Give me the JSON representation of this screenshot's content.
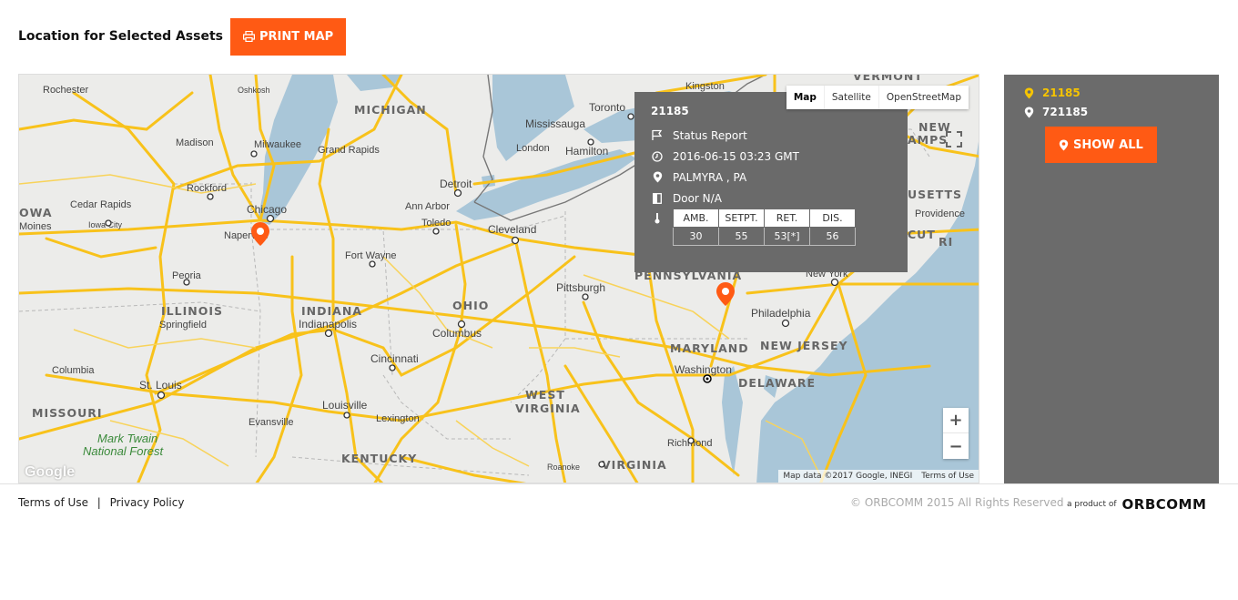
{
  "header": {
    "title": "Location for Selected Assets",
    "print_label": "PRINT MAP"
  },
  "map": {
    "map_types": [
      "Map",
      "Satellite",
      "OpenStreetMap"
    ],
    "active_map_type": "Map",
    "zoom_in": "+",
    "zoom_out": "−",
    "attribution": "Map data ©2017 Google, INEGI",
    "terms": "Terms of Use",
    "google_logo": "Google",
    "labels": {
      "michigan": "MICHIGAN",
      "illinois": "ILLINOIS",
      "indiana": "INDIANA",
      "ohio": "OHIO",
      "pennsylvania": "PENNSYLVANIA",
      "maryland": "MARYLAND",
      "new_jersey": "NEW JERSEY",
      "delaware": "DELAWARE",
      "west_virginia_1": "WEST",
      "west_virginia_2": "VIRGINIA",
      "virginia": "VIRGINIA",
      "kentucky": "KENTUCKY",
      "missouri": "MISSOURI",
      "iowa": "OWA",
      "vermont": "VERMONT",
      "new_hampshire_1": "NEW",
      "new_hampshire_2": "AMPS",
      "massachusetts": "USETTS",
      "connecticut": "CUT",
      "rhode_island": "RI",
      "mark_twain_1": "Mark Twain",
      "mark_twain_2": "National Forest",
      "rochester": "Rochester",
      "oshkosh": "Oshkosh",
      "madison": "Madison",
      "milwaukee": "Milwaukee",
      "grand_rapids": "Grand Rapids",
      "rockford": "Rockford",
      "cedar_rapids": "Cedar Rapids",
      "iowa_city": "Iowa City",
      "moines": "Moines",
      "chicago": "Chicago",
      "naperville": "Naperville",
      "peoria": "Peoria",
      "springfield": "Springfield",
      "columbia": "Columbia",
      "st_louis": "St. Louis",
      "indianapolis": "Indianapolis",
      "fort_wayne": "Fort Wayne",
      "detroit": "Detroit",
      "ann_arbor": "Ann Arbor",
      "toledo": "Toledo",
      "cleveland": "Cleveland",
      "columbus": "Columbus",
      "cincinnati": "Cincinnati",
      "louisville": "Louisville",
      "lexington": "Lexington",
      "evansville": "Evansville",
      "pittsburgh": "Pittsburgh",
      "philadelphia": "Philadelphia",
      "washington": "Washington",
      "richmond": "Richmond",
      "roanoke": "Roanoke",
      "toronto": "Toronto",
      "mississauga": "Mississauga",
      "hamilton": "Hamilton",
      "london": "London",
      "kingston": "Kingston",
      "new_york": "New York",
      "providence": "Providence"
    }
  },
  "popup": {
    "asset_id": "21185",
    "event": "Status Report",
    "timestamp": "2016-06-15 03:23 GMT",
    "location": "PALMYRA , PA",
    "door": "Door N/A",
    "temp_headers": [
      "AMB.",
      "SETPT.",
      "RET.",
      "DIS."
    ],
    "temp_values": [
      "30",
      "55",
      "53[*]",
      "56"
    ]
  },
  "sidebar": {
    "assets": [
      {
        "id": "21185",
        "selected": true
      },
      {
        "id": "721185",
        "selected": false
      }
    ],
    "show_all_label": "SHOW ALL"
  },
  "footer": {
    "terms": "Terms of Use",
    "separator": "|",
    "privacy": "Privacy Policy",
    "copyright": "© ORBCOMM 2015 All Rights Reserved",
    "product_of": "a product of",
    "brand": "ORBCOMM"
  },
  "colors": {
    "accent": "#ff5a14",
    "selected": "#f6c400",
    "panel": "#6b6b6b",
    "road": "#f8c21b",
    "water": "#a9c6d8"
  }
}
